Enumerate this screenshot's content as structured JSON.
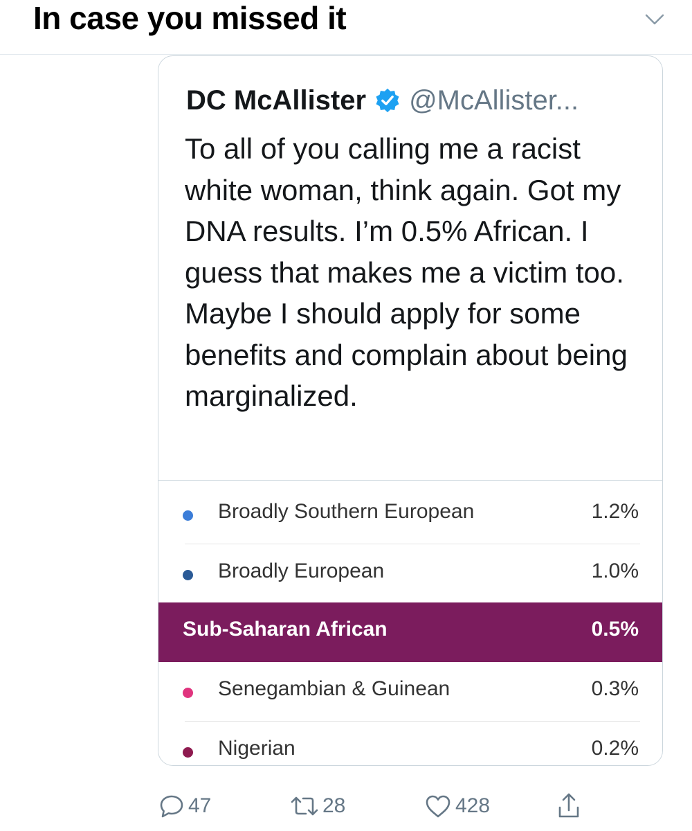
{
  "header": {
    "title": "In case you missed it",
    "chevron_icon": "chevron-down-icon"
  },
  "tweet": {
    "author_name": "DC McAllister",
    "verified_icon": "verified-badge-icon",
    "handle": "@McAllister...",
    "text": "To all of you calling me a racist white woman, think again. Got my DNA results. I’m 0.5% African. I guess that makes me a victim too. Maybe I should apply for some benefits and complain about being marginalized.",
    "media": {
      "rows": [
        {
          "label": "Broadly Southern European",
          "value": "1.2%",
          "dot_color": "#3b7dd8",
          "highlight": false
        },
        {
          "label": "Broadly European",
          "value": "1.0%",
          "dot_color": "#2a5a96",
          "highlight": false
        },
        {
          "label": "Sub-Saharan African",
          "value": "0.5%",
          "dot_color": "",
          "highlight": true,
          "highlight_color": "#7b1c5d"
        },
        {
          "label": "Senegambian & Guinean",
          "value": "0.3%",
          "dot_color": "#e0347e",
          "highlight": false
        },
        {
          "label": "Nigerian",
          "value": "0.2%",
          "dot_color": "#8e1a4f",
          "highlight": false
        }
      ]
    }
  },
  "actions": {
    "reply": {
      "icon": "reply-icon",
      "count": "47"
    },
    "retweet": {
      "icon": "retweet-icon",
      "count": "28"
    },
    "like": {
      "icon": "heart-icon",
      "count": "428"
    },
    "share": {
      "icon": "share-icon"
    }
  }
}
